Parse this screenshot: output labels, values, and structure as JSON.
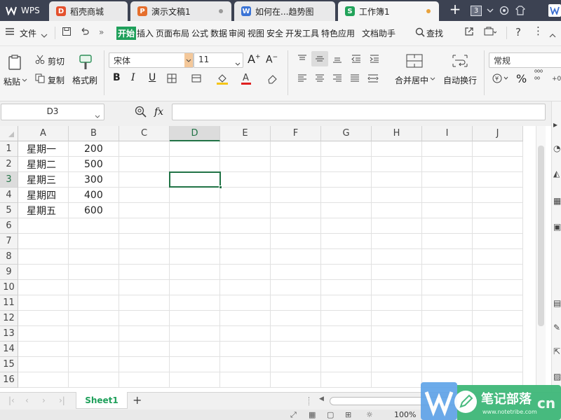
{
  "titlebar": {
    "app_tab": "WPS",
    "tabs": [
      {
        "label": "稻壳商城",
        "icon_text": "D",
        "icon_color": "#e4502d"
      },
      {
        "label": "演示文稿1",
        "icon_text": "P",
        "icon_color": "#e56e2c"
      },
      {
        "label": "如何在...趋势图",
        "icon_text": "W",
        "icon_color": "#3b74d6"
      },
      {
        "label": "工作簿1",
        "icon_text": "S",
        "icon_color": "#22a35a"
      }
    ],
    "window_count": "3",
    "colors": {
      "bar": "#3c4252",
      "accent": "#1fa05b"
    }
  },
  "menubar": {
    "hamburger_icon": "menu-icon",
    "file_label": "文件",
    "items": [
      "开始",
      "插入",
      "页面布局",
      "公式",
      "数据",
      "审阅",
      "视图",
      "安全",
      "开发工具",
      "特色应用",
      "文档助手"
    ],
    "active_index": 0,
    "search_label": "查找"
  },
  "ribbon": {
    "paste_label": "粘贴",
    "cut_label": "剪切",
    "copy_label": "复制",
    "format_painter_label": "格式刷",
    "font_name": "宋体",
    "font_size": "11",
    "bold": "B",
    "italic": "I",
    "underline": "U",
    "merge_label": "合并居中",
    "wrap_label": "自动换行",
    "number_format": "常规",
    "percent": "%"
  },
  "formula_bar": {
    "name_box": "D3",
    "fx_label": "fx",
    "formula": ""
  },
  "grid": {
    "columns": [
      "A",
      "B",
      "C",
      "D",
      "E",
      "F",
      "G",
      "H",
      "I",
      "J"
    ],
    "selected_column": "D",
    "rows": [
      "1",
      "2",
      "3",
      "4",
      "5",
      "6",
      "7",
      "8",
      "9",
      "10",
      "11",
      "12",
      "13",
      "14",
      "15",
      "16"
    ],
    "selected_row": "3",
    "cells": [
      {
        "a": "星期一",
        "b": "200"
      },
      {
        "a": "星期二",
        "b": "500"
      },
      {
        "a": "星期三",
        "b": "300"
      },
      {
        "a": "星期四",
        "b": "400"
      },
      {
        "a": "星期五",
        "b": "600"
      }
    ],
    "active_cell": "D3"
  },
  "sheets": {
    "tabs": [
      "Sheet1"
    ],
    "add_label": "+"
  },
  "statusbar": {
    "zoom": "100%"
  },
  "watermark": {
    "text": "笔记部落",
    "sub": "www.notetribe.com",
    "suffix": "cn"
  }
}
